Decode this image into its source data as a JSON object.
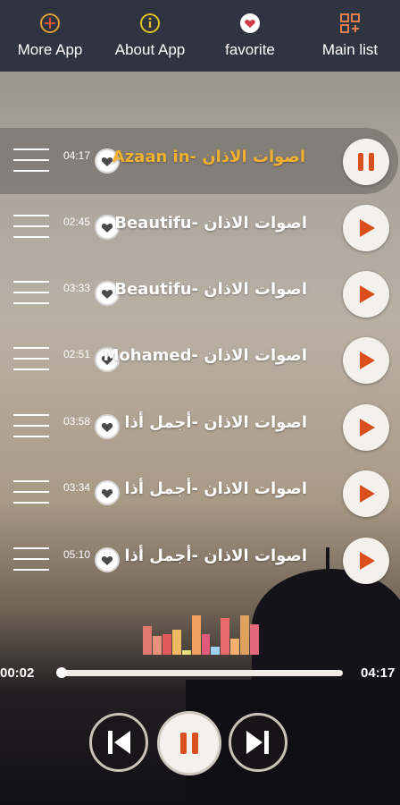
{
  "nav": [
    {
      "label": "More App",
      "icon": "apps-plus-icon"
    },
    {
      "label": "About App",
      "icon": "info-icon"
    },
    {
      "label": "favorite",
      "icon": "heart-icon"
    },
    {
      "label": "Main list",
      "icon": "grid-list-icon"
    }
  ],
  "tracks": [
    {
      "duration": "04:17",
      "title": "اصوات الاذان -Azaan in",
      "active": true
    },
    {
      "duration": "02:45",
      "title": "اصوات الاذان -Beautifu",
      "active": false
    },
    {
      "duration": "03:33",
      "title": "اصوات الاذان -Beautifu",
      "active": false
    },
    {
      "duration": "02:51",
      "title": "اصوات الاذان -Mohamed",
      "active": false
    },
    {
      "duration": "03:58",
      "title": "اصوات الاذان -أجمل أذا",
      "active": false
    },
    {
      "duration": "03:34",
      "title": "اصوات الاذان -أجمل أذا",
      "active": false
    },
    {
      "duration": "05:10",
      "title": "اصوات الاذان -أجمل أذا",
      "active": false
    }
  ],
  "player": {
    "elapsed": "00:02",
    "total": "04:17",
    "progress_fraction": 0.01
  },
  "equalizer_levels": [
    0.7,
    0.45,
    0.5,
    0.6,
    0.1,
    0.95,
    0.5,
    0.2,
    0.9,
    0.4,
    0.95,
    0.75
  ],
  "colors": {
    "accent_orange": "#f2b230",
    "play_red": "#d9501e",
    "topbar": "#2f3540",
    "eq_colors": [
      "#e07a70",
      "#e8927a",
      "#e25a5a",
      "#f0b860",
      "#e8e07a",
      "#f0a060",
      "#e25a7a",
      "#a0d0f0",
      "#e86a6a",
      "#f5b070",
      "#e0a060",
      "#e06a7a"
    ]
  }
}
